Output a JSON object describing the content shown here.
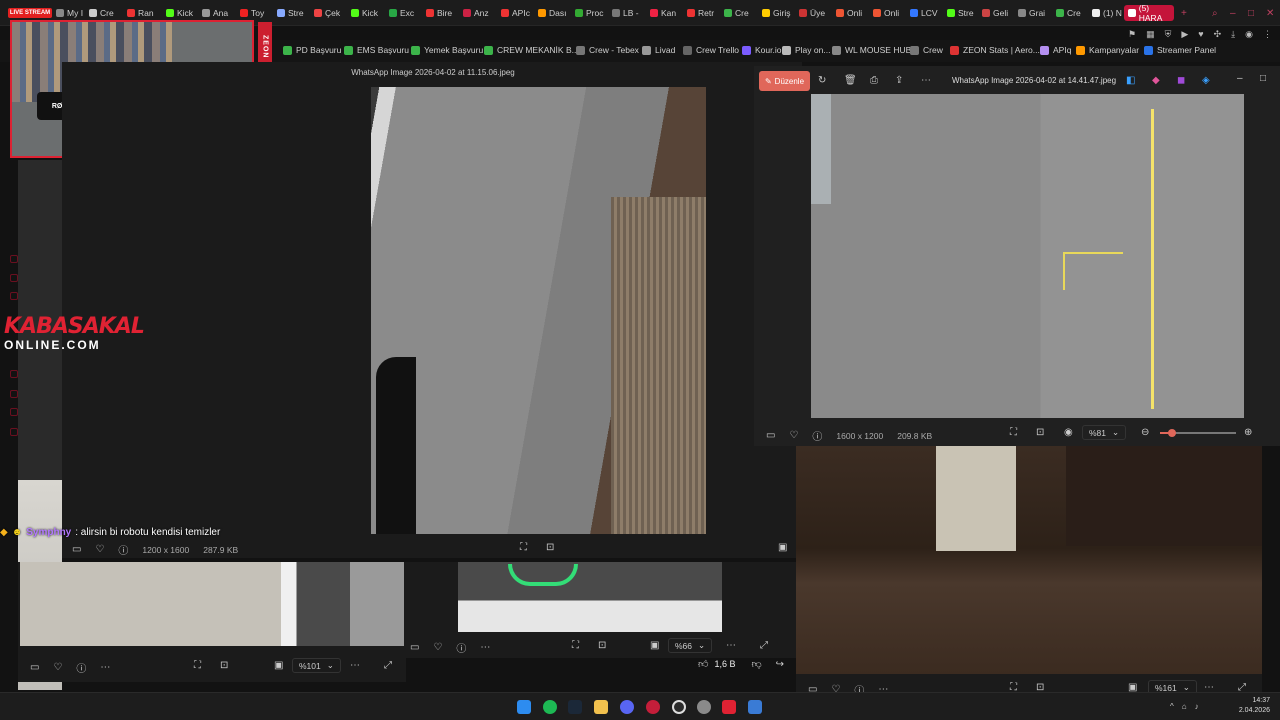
{
  "browser": {
    "live_label": "LIVE STREAM",
    "tabs": [
      "My I",
      "Cre",
      "Ran",
      "Kick",
      "Ana",
      "Toy",
      "Stre",
      "Çek",
      "Kick",
      "Exc",
      "Bire",
      "Anz",
      "APIc",
      "Dası",
      "Proc",
      "LB -",
      "Kan",
      "Retr",
      "Cre",
      "Giriş",
      "Üye",
      "Onli",
      "Onli",
      "LCV",
      "Stre",
      "Geli",
      "Grai",
      "Cre",
      "(1) N"
    ],
    "active_tab": "(5) HARA",
    "bookmarks": [
      "PD Başvuru",
      "EMS Başvuru",
      "Yemek Başvuru",
      "CREW MEKANİK B...",
      "Crew - Tebex",
      "Livad",
      "Crew Trello",
      "Kour.io",
      "Play on...",
      "WL MOUSE HUB",
      "Crew",
      "ZEON Stats | Aero...",
      "APIq",
      "Kampanyalar",
      "Streamer Panel"
    ]
  },
  "overlay": {
    "webcam_mic_label": "RØDE",
    "sponsor": "ZEON",
    "logo_line1": "KABASAKAL",
    "logo_line2": "ONLINE.COM",
    "chat": {
      "user": "Symphny",
      "message": ": alirsin bi robotu kendisi temizler"
    }
  },
  "viewer_main": {
    "title": "WhatsApp Image 2026-04-02 at 11.15.06.jpeg",
    "dimensions": "1200 x 1600",
    "size": "287.9 KB"
  },
  "viewer_right": {
    "edit_label": "Düzenle",
    "title": "WhatsApp Image 2026-04-02 at 14.41.47.jpeg",
    "dimensions": "1600 x 1200",
    "size": "209.8 KB",
    "zoom": "%81"
  },
  "viewer_bottom_left": {
    "zoom": "%101"
  },
  "viewer_bottom_mid": {
    "zoom": "%66",
    "likes": "1,6 B"
  },
  "viewer_bottom_right": {
    "zoom": "%161"
  },
  "taskbar": {
    "time": "14:37",
    "date": "2.04.2026"
  },
  "colors": {
    "accent": "#dd2233",
    "edit_button": "#e0675a",
    "tab_active": "#c4143a",
    "chat_user": "#b277ff"
  }
}
